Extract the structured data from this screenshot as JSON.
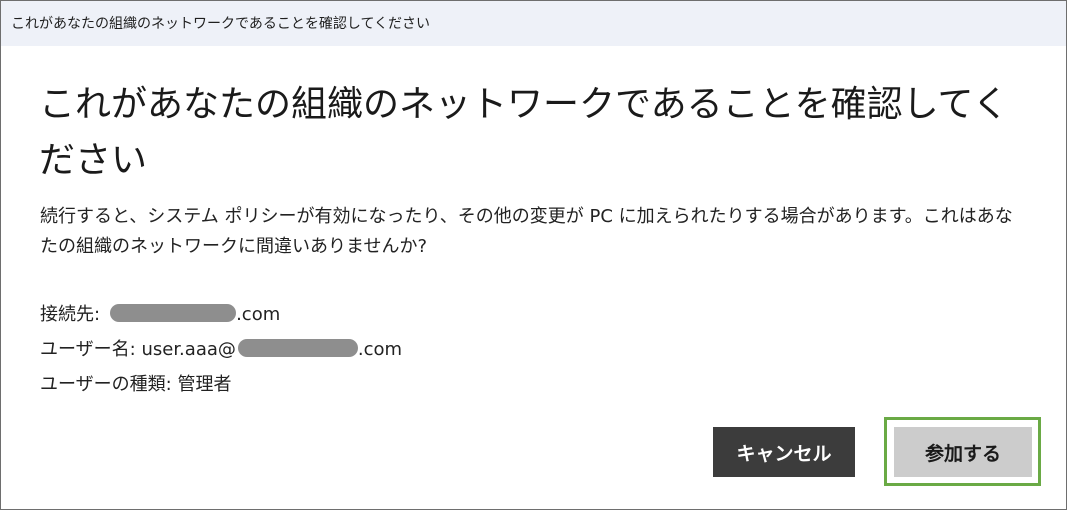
{
  "window": {
    "title": "これがあなたの組織のネットワークであることを確認してください"
  },
  "dialog": {
    "heading": "これがあなたの組織のネットワークであることを確認してください",
    "description": "続行すると、システム ポリシーが有効になったり、その他の変更が PC に加えられたりする場合があります。これはあなたの組織のネットワークに間違いありませんか?",
    "connection_label": "接続先:",
    "connection_suffix": ".com",
    "username_label": "ユーザー名:",
    "username_prefix": "user.aaa@",
    "username_suffix": ".com",
    "usertype_label": "ユーザーの種類:",
    "usertype_value": "管理者"
  },
  "buttons": {
    "cancel_label": "キャンセル",
    "join_label": "参加する"
  },
  "colors": {
    "titlebar": "#eef1f8",
    "cancel_bg": "#3c3c3c",
    "join_bg": "#cccccc",
    "join_highlight": "#6aaa45",
    "redaction": "#8e8e8e"
  }
}
